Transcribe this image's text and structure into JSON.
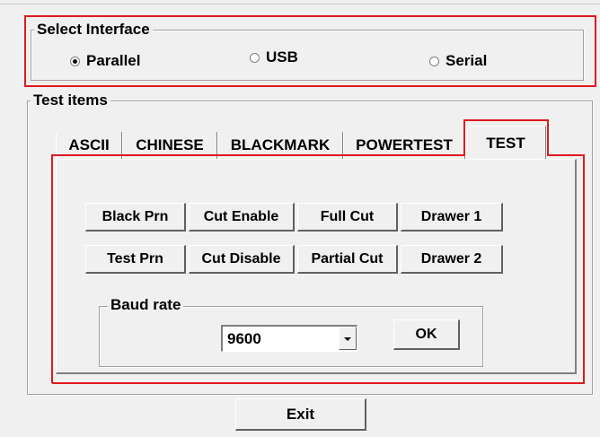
{
  "interface": {
    "title": "Select Interface",
    "options": [
      {
        "label": "Parallel",
        "checked": true
      },
      {
        "label": "USB",
        "checked": false
      },
      {
        "label": "Serial",
        "checked": false
      }
    ]
  },
  "test_items": {
    "title": "Test items",
    "tabs": [
      {
        "label": "ASCII",
        "active": false
      },
      {
        "label": "CHINESE",
        "active": false
      },
      {
        "label": "BLACKMARK",
        "active": false
      },
      {
        "label": "POWERTEST",
        "active": false
      },
      {
        "label": "TEST",
        "active": true
      }
    ]
  },
  "test_panel": {
    "buttons_row1": [
      "Black Prn",
      "Cut Enable",
      "Full Cut",
      "Drawer 1"
    ],
    "buttons_row2": [
      "Test Prn",
      "Cut Disable",
      "Partial Cut",
      "Drawer 2"
    ],
    "baud": {
      "title": "Baud rate",
      "value": "9600",
      "ok_label": "OK"
    }
  },
  "footer": {
    "exit_label": "Exit"
  },
  "colors": {
    "highlight": "#e0191e",
    "background": "#f0f0f0"
  }
}
